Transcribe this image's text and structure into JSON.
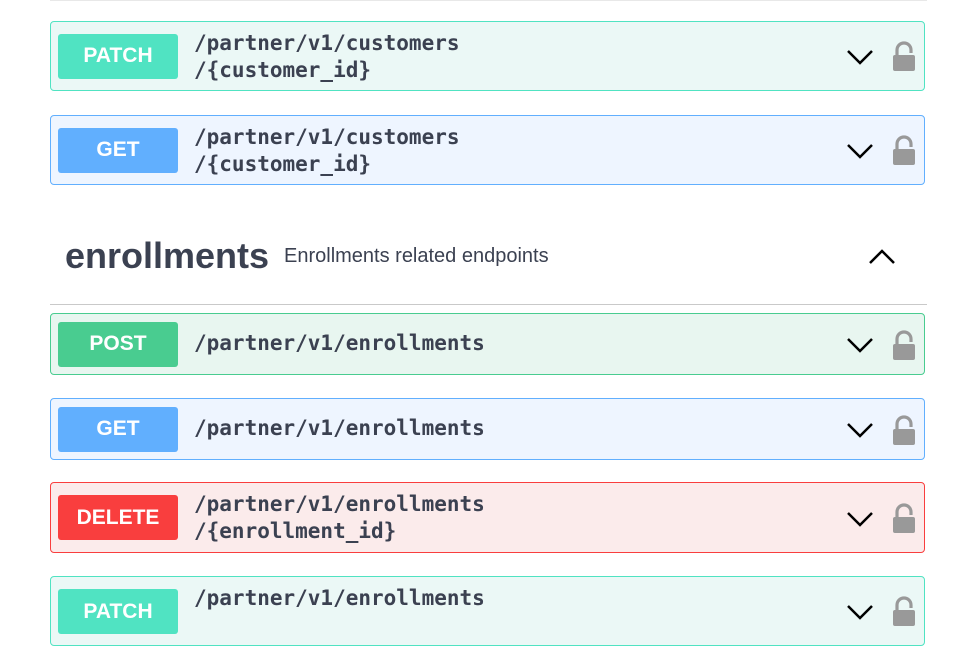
{
  "operations_top": [
    {
      "method": "PATCH",
      "path": "/partner/v1/customers\n/{customer_id}"
    },
    {
      "method": "GET",
      "path": "/partner/v1/customers\n/{customer_id}"
    }
  ],
  "tag": {
    "name": "enrollments",
    "description": "Enrollments related endpoints"
  },
  "operations_enrollments": [
    {
      "method": "POST",
      "path": "/partner/v1/enrollments"
    },
    {
      "method": "GET",
      "path": "/partner/v1/enrollments"
    },
    {
      "method": "DELETE",
      "path": "/partner/v1/enrollments\n/{enrollment_id}"
    },
    {
      "method": "PATCH",
      "path": "/partner/v1/enrollments"
    }
  ],
  "icons": {
    "expand": "chevron-down-icon",
    "collapse": "chevron-up-icon",
    "authorize": "lock-icon"
  },
  "colors": {
    "patch": "#50e3c2",
    "get": "#61affe",
    "post": "#49cc90",
    "delete": "#f93e3e",
    "text": "#3b4151"
  }
}
